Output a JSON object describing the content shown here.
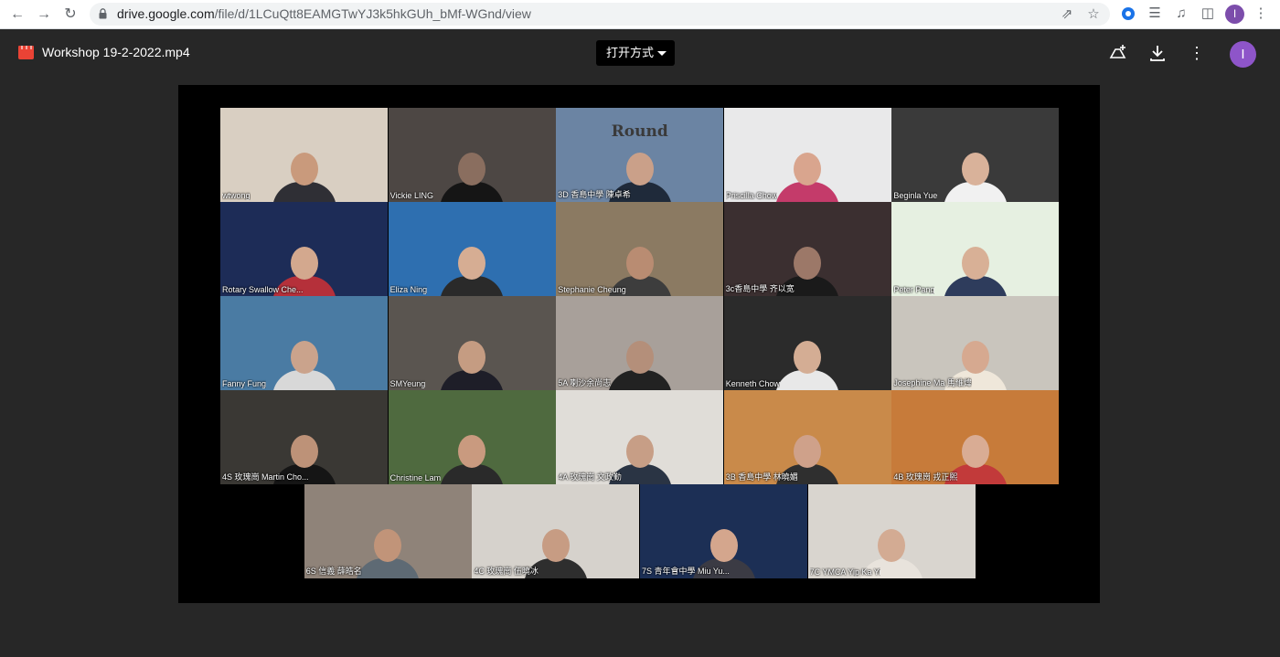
{
  "browser": {
    "url_host": "drive.google.com",
    "url_path": "/file/d/1LCuQtt8EAMGTwYJ3k5hkGUh_bMf-WGnd/view",
    "profile_initial": "I"
  },
  "viewer": {
    "file_title": "Workshop 19-2-2022.mp4",
    "open_with_label": "打开方式",
    "profile_initial": "I"
  },
  "participants": [
    {
      "name": "wtwong",
      "bg": "#d9cfc2",
      "skin": "#c99a7c",
      "shirt": "#2f2f35"
    },
    {
      "name": "Vickie LING",
      "bg": "#4d4744",
      "skin": "#8a6e5f",
      "shirt": "#151515"
    },
    {
      "name": "3D 香島中學 陳卓希",
      "bg": "#6b84a3",
      "skin": "#caa089",
      "shirt": "#1f2a3a",
      "banner": "Round"
    },
    {
      "name": "Priscilla Chow",
      "bg": "#e9e9ea",
      "skin": "#d9a58e",
      "shirt": "#c43b6a"
    },
    {
      "name": "Beginla Yue",
      "bg": "#3a3a3a",
      "skin": "#d9b29a",
      "shirt": "#f1f1f1"
    },
    {
      "name": "Rotary Swallow Che...",
      "bg": "#1d2c57",
      "skin": "#d3a88e",
      "shirt": "#b5303a"
    },
    {
      "name": "Eliza Ning",
      "bg": "#2e6fb0",
      "skin": "#d6ad93",
      "shirt": "#2a2a2a"
    },
    {
      "name": "Stephanie Cheung",
      "bg": "#8b7a62",
      "skin": "#b98c72",
      "shirt": "#3d3d3d"
    },
    {
      "name": "3c香島中學 齐以宽",
      "bg": "#3b2f30",
      "skin": "#9c7868",
      "shirt": "#1a1a1a"
    },
    {
      "name": "Peter Pang",
      "bg": "#e6f0e1",
      "skin": "#d8b096",
      "shirt": "#2e3c5c"
    },
    {
      "name": "Fanny Fung",
      "bg": "#4a7ba3",
      "skin": "#caa38c",
      "shirt": "#d8d8d8"
    },
    {
      "name": "SMYeung",
      "bg": "#5a5550",
      "skin": "#c59c82",
      "shirt": "#1e1e28"
    },
    {
      "name": "5A 喇沙余尚志",
      "bg": "#a8a09a",
      "skin": "#b48f7a",
      "shirt": "#222222"
    },
    {
      "name": "Kenneth Chow",
      "bg": "#2b2b2b",
      "skin": "#d4ad94",
      "shirt": "#e8e8e8"
    },
    {
      "name": "Josephine Ma 馬維煒",
      "bg": "#c9c5bd",
      "skin": "#d6a990",
      "shirt": "#efe7da"
    },
    {
      "name": "4S 玫瑰崗 Martin Cho...",
      "bg": "#3a3834",
      "skin": "#bd9278",
      "shirt": "#151515"
    },
    {
      "name": "Christine Lam",
      "bg": "#4f6a3f",
      "skin": "#c99a7f",
      "shirt": "#2a2a2a"
    },
    {
      "name": "4A 玫瑰崗 文政勤",
      "bg": "#e0ddd8",
      "skin": "#c79e86",
      "shirt": "#2a3444"
    },
    {
      "name": "3B 香島中學 林曉媚",
      "bg": "#c98a4a",
      "skin": "#cfa18a",
      "shirt": "#2f2f2f"
    },
    {
      "name": "4B 玫瑰崗 戎正熙",
      "bg": "#c77b3a",
      "skin": "#d9ac94",
      "shirt": "#c23a3a"
    },
    {
      "name": "6S 信義 薛皓名",
      "bg": "#8f8379",
      "skin": "#c19479",
      "shirt": "#5e6a74"
    },
    {
      "name": "4C 玫瑰崗 伍曉冰",
      "bg": "#d6d2cc",
      "skin": "#c79c83",
      "shirt": "#2e2e2e"
    },
    {
      "name": "7S 青年會中學 Miu Yu...",
      "bg": "#1c2f55",
      "skin": "#d4a68d",
      "shirt": "#3b3b44"
    },
    {
      "name": "7C YMCA Yip Ka Yi",
      "bg": "#d9d5cf",
      "skin": "#d3ab93",
      "shirt": "#e8e3dc"
    }
  ]
}
